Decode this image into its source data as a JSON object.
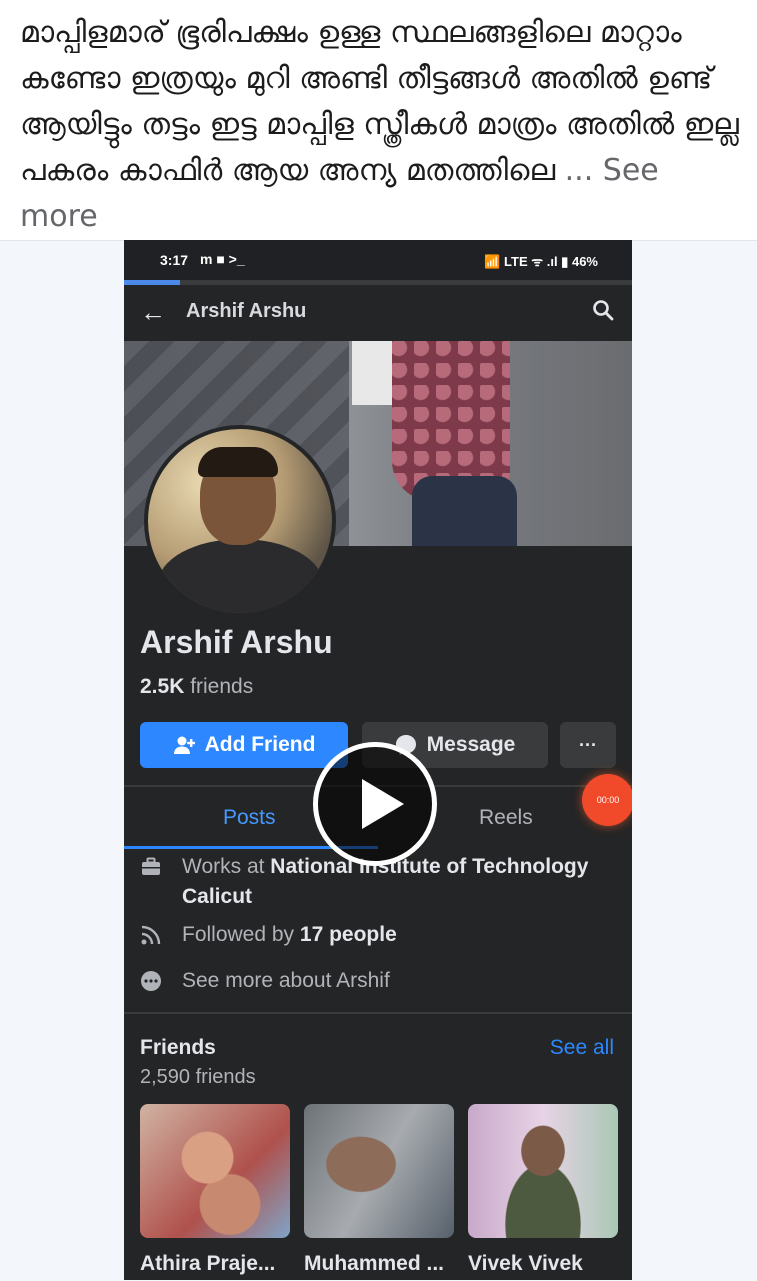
{
  "post": {
    "text": "മാപ്പിളമാര് ഭൂരിപക്ഷം ഉള്ള സ്ഥലങ്ങളിലെ മാറ്റാം കണ്ടോ ഇത്രയും മുറി അണ്ടി തീട്ടങ്ങൾ അതിൽ ഉണ്ട് ആയിട്ടും തട്ടം ഇട്ട മാപ്പിള സ്ത്രീകൾ മാത്രം അതിൽ ഇല്ല പകരം കാഫിർ ആയ അന്യ മതത്തിലെ ",
    "ellipsis": "... ",
    "see_more": "See more"
  },
  "status_bar": {
    "time": "3:17",
    "left_icons": "m ■ >_",
    "right_icons": "📶 LTE ᯤ .ıl ▮",
    "battery": "46%"
  },
  "app_bar": {
    "title": "Arshif Arshu"
  },
  "profile": {
    "name": "Arshif Arshu",
    "friends_count": "2.5K",
    "friends_label": " friends"
  },
  "actions": {
    "add_friend": "Add Friend",
    "message": "Message",
    "more": "···"
  },
  "tabs": {
    "posts": "Posts",
    "reels": "Reels"
  },
  "recording": {
    "timer": "00:00"
  },
  "about": {
    "work_prefix": "Works at ",
    "work_place": "National Institute of Technology Calicut",
    "followed_prefix": "Followed by ",
    "followed_count": "17 people",
    "see_more_about": "See more about Arshif"
  },
  "friends_section": {
    "title": "Friends",
    "count_label": "2,590 friends",
    "see_all": "See all",
    "items": [
      {
        "name": "Athira Praje..."
      },
      {
        "name": "Muhammed ..."
      },
      {
        "name": "Vivek Vivek"
      }
    ]
  },
  "colors": {
    "accent": "#2d88ff",
    "background_dark": "#242526",
    "record_red": "#f04a2a"
  }
}
